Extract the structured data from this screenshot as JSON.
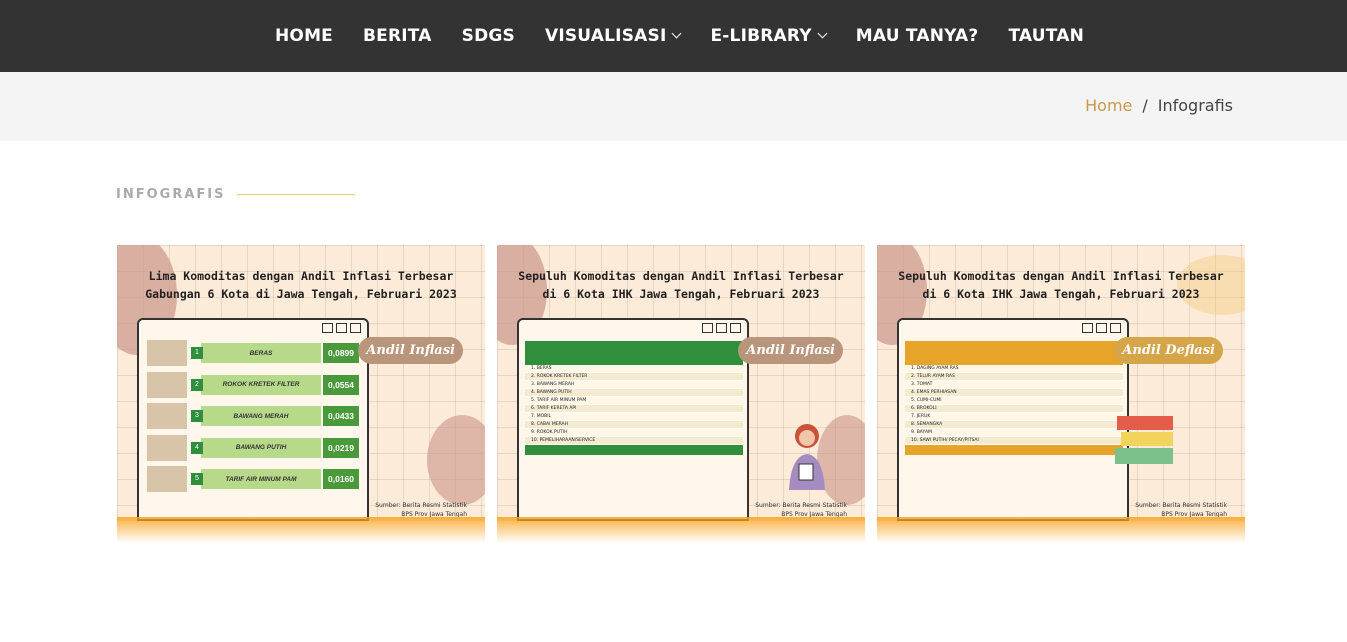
{
  "nav": {
    "items": [
      {
        "label": "HOME",
        "dropdown": false
      },
      {
        "label": "BERITA",
        "dropdown": false
      },
      {
        "label": "SDGS",
        "dropdown": false
      },
      {
        "label": "VISUALISASI",
        "dropdown": true
      },
      {
        "label": "E-LIBRARY",
        "dropdown": true
      },
      {
        "label": "MAU TANYA?",
        "dropdown": false
      },
      {
        "label": "TAUTAN",
        "dropdown": false
      }
    ]
  },
  "breadcrumb": {
    "home": "Home",
    "separator": "/",
    "current": "Infografis"
  },
  "section": {
    "title": "INFOGRAFIS"
  },
  "cards": [
    {
      "title_line1": "Lima Komoditas dengan Andil Inflasi Terbesar",
      "title_line2": "Gabungan 6 Kota di Jawa Tengah, Februari 2023",
      "bubble": "Andil Inflasi",
      "bubble_color": "#b9957b",
      "source_line1": "Sumber: Berita Resmi Statistik",
      "source_line2": "BPS Prov Jawa Tengah",
      "items": [
        {
          "no": "1",
          "name": "BERAS",
          "value": "0,0899"
        },
        {
          "no": "2",
          "name": "ROKOK KRETEK FILTER",
          "value": "0,0554"
        },
        {
          "no": "3",
          "name": "BAWANG MERAH",
          "value": "0,0433"
        },
        {
          "no": "4",
          "name": "BAWANG PUTIH",
          "value": "0,0219"
        },
        {
          "no": "5",
          "name": "TARIF AIR MINUM PAM",
          "value": "0,0160"
        }
      ]
    },
    {
      "title_line1": "Sepuluh Komoditas dengan Andil Inflasi Terbesar",
      "title_line2": "di 6 Kota IHK Jawa Tengah, Februari 2023",
      "bubble": "Andil Inflasi",
      "bubble_color": "#b9957b",
      "header_color": "#2f8f3c",
      "source_line1": "Sumber: Berita Resmi Statistik",
      "source_line2": "BPS Prov Jawa Tengah",
      "rows": [
        "1. BERAS",
        "2. ROKOK KRETEK FILTER",
        "3. BAWANG MERAH",
        "4. BAWANG PUTIH",
        "5. TARIF AIR MINUM PAM",
        "6. TARIF KERETA API",
        "7. MOBIL",
        "8. CABAI MERAH",
        "9. ROKOK PUTIH",
        "10. PEMELIHARAAN/SERVICE"
      ]
    },
    {
      "title_line1": "Sepuluh Komoditas dengan Andil Inflasi Terbesar",
      "title_line2": "di 6 Kota IHK Jawa Tengah, Februari 2023",
      "bubble": "Andil Deflasi",
      "bubble_color": "#d6a54a",
      "header_color": "#e6a52a",
      "source_line1": "Sumber: Berita Resmi Statistik",
      "source_line2": "BPS Prov Jawa Tengah",
      "rows": [
        "1. DAGING AYAM RAS",
        "2. TELUR AYAM RAS",
        "3. TOMAT",
        "4. EMAS PERHIASAN",
        "5. CUMI-CUMI",
        "6. BROKOLI",
        "7. JERUK",
        "8. SEMANGKA",
        "9. BAYAM",
        "10. SAWI PUTIH/ PECAY/PITSAI"
      ]
    }
  ]
}
